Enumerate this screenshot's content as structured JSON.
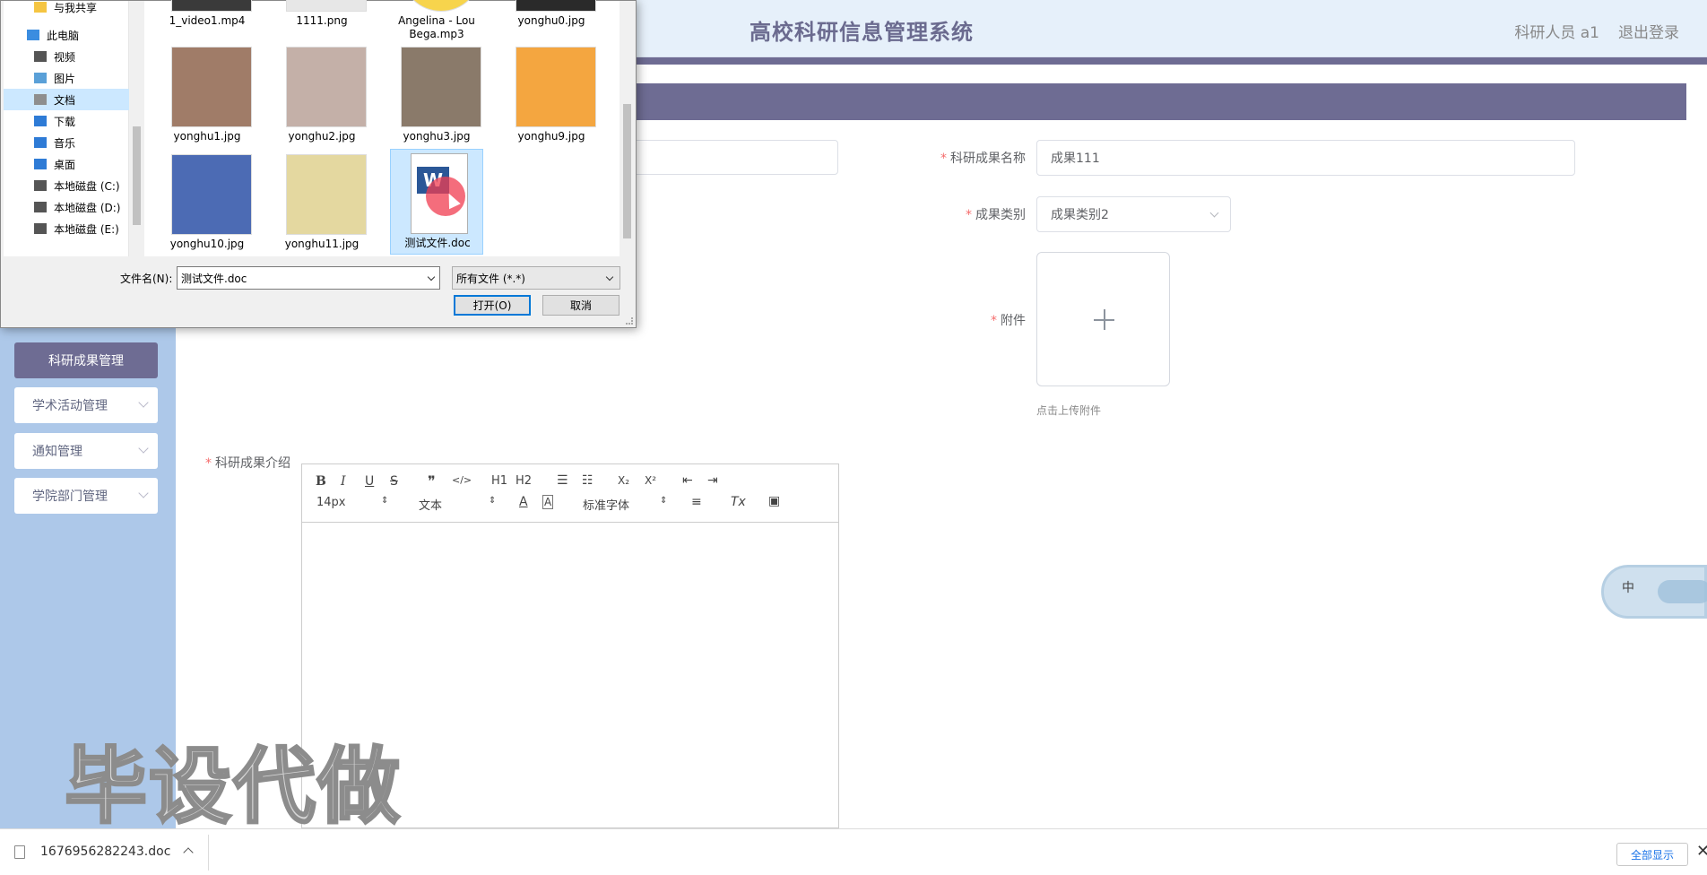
{
  "header": {
    "title": "高校科研信息管理系统",
    "user": "科研人员 a1",
    "logout": "退出登录"
  },
  "sidebar": {
    "items": [
      {
        "label": "科研成果管理",
        "active": true
      },
      {
        "label": "学术活动管理",
        "active": false
      },
      {
        "label": "通知管理",
        "active": false
      },
      {
        "label": "学院部门管理",
        "active": false
      }
    ]
  },
  "form": {
    "name_label": "科研成果名称",
    "name_value": "成果111",
    "category_label": "成果类别",
    "category_value": "成果类别2",
    "attachment_label": "附件",
    "attachment_tip": "点击上传附件",
    "intro_label": "科研成果介绍",
    "required_mark": "*"
  },
  "editor": {
    "toolbar": {
      "bold": "B",
      "italic": "I",
      "underline": "U",
      "strike": "S",
      "quote": "❞",
      "code": "</>",
      "h1": "H1",
      "h2": "H2",
      "ordered_list": "☰",
      "bullet_list": "☷",
      "sub": "X₂",
      "sup": "X²",
      "outdent": "⇤",
      "indent": "⇥",
      "size": "14px",
      "format": "文本",
      "color": "A",
      "bg": "A",
      "font": "标准字体",
      "align": "≡",
      "clear": "Tx",
      "image": "▣"
    }
  },
  "float_widget": {
    "label": "中"
  },
  "watermark": "毕设代做",
  "download_bar": {
    "file": "1676956282243.doc",
    "show_all": "全部显示",
    "close": "✕"
  },
  "file_dialog": {
    "tree": [
      {
        "label": "与我共享",
        "icon": "folder-icon",
        "color": "#f5c542"
      },
      {
        "label": "此电脑",
        "icon": "computer-icon",
        "color": "#3b8de0"
      },
      {
        "label": "视频",
        "icon": "video-icon",
        "color": "#555555"
      },
      {
        "label": "图片",
        "icon": "pictures-icon",
        "color": "#5aa0d8"
      },
      {
        "label": "文档",
        "icon": "documents-icon",
        "color": "#8e8e8e",
        "selected": true
      },
      {
        "label": "下载",
        "icon": "download-icon",
        "color": "#2e7bd6"
      },
      {
        "label": "音乐",
        "icon": "music-icon",
        "color": "#2e7bd6"
      },
      {
        "label": "桌面",
        "icon": "desktop-icon",
        "color": "#2e7bd6"
      },
      {
        "label": "本地磁盘 (C:)",
        "icon": "drive-icon",
        "color": "#555555"
      },
      {
        "label": "本地磁盘 (D:)",
        "icon": "drive-icon",
        "color": "#555555"
      },
      {
        "label": "本地磁盘 (E:)",
        "icon": "drive-icon",
        "color": "#555555"
      }
    ],
    "files": [
      {
        "name": "1_video1.mp4",
        "thumb": "#3a3a3a"
      },
      {
        "name": "1111.png",
        "thumb": "#e7e7e7"
      },
      {
        "name": "Angelina - Lou Bega.mp3",
        "thumb": "#f7d44c"
      },
      {
        "name": "yonghu0.jpg",
        "thumb": "#2a2a2a"
      },
      {
        "name": "yonghu1.jpg",
        "thumb": "#a07c68"
      },
      {
        "name": "yonghu2.jpg",
        "thumb": "#c4b0a8"
      },
      {
        "name": "yonghu3.jpg",
        "thumb": "#8a7a6a"
      },
      {
        "name": "yonghu9.jpg",
        "thumb": "#f4a640"
      },
      {
        "name": "yonghu10.jpg",
        "thumb": "#4c6bb4"
      },
      {
        "name": "yonghu11.jpg",
        "thumb": "#e4d8a0"
      },
      {
        "name": "测试文件.doc",
        "thumb": "#ffffff",
        "selected": true
      }
    ],
    "filename_label": "文件名(N):",
    "filename_value": "测试文件.doc",
    "filetype_value": "所有文件 (*.*)",
    "open_button": "打开(O)",
    "cancel_button": "取消"
  }
}
